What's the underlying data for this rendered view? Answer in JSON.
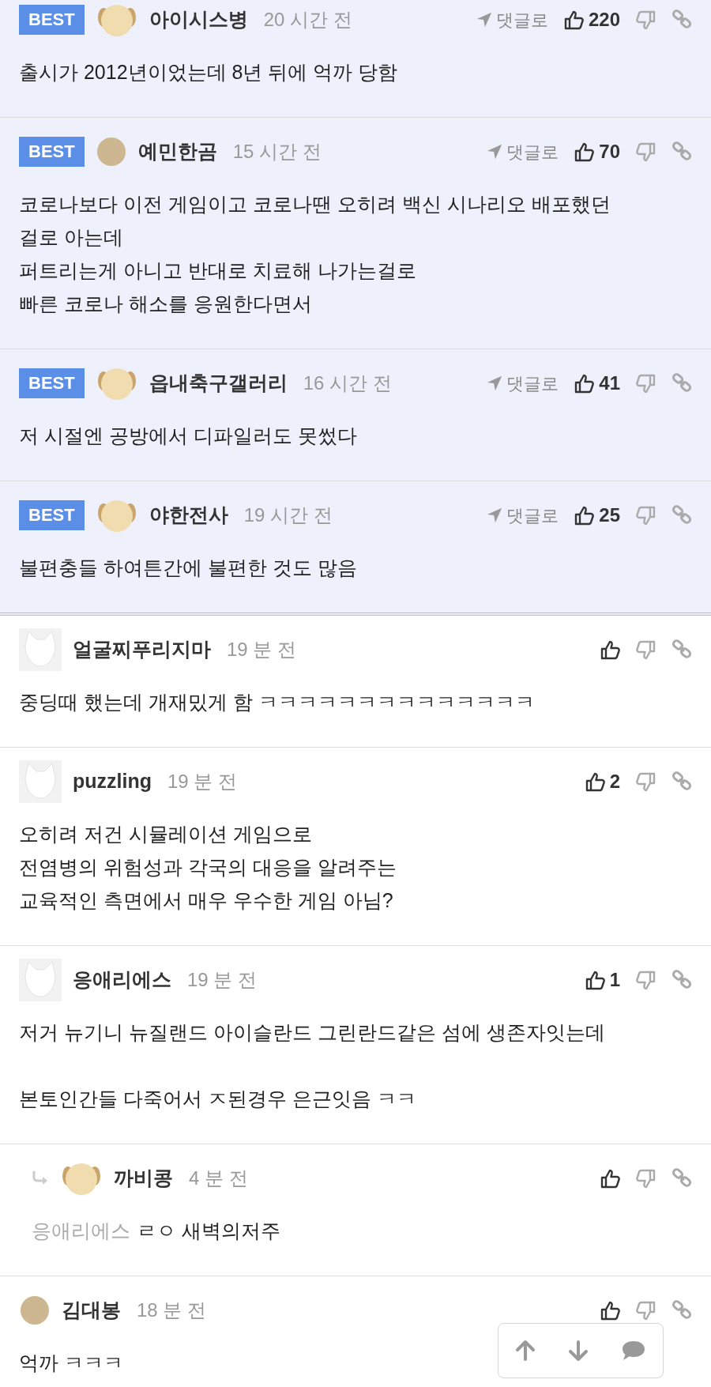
{
  "comments": [
    {
      "badge": "BEST",
      "avatar": {
        "kind": "dog"
      },
      "author": "아이시스병",
      "time": "20 시간 전",
      "reply_label": "댓글로",
      "likes": "220",
      "paragraphs": [
        "출시가 2012년이었는데 8년 뒤에 억까 당함"
      ]
    },
    {
      "badge": "BEST",
      "avatar": {
        "kind": "round"
      },
      "author": "예민한곰",
      "time": "15 시간 전",
      "reply_label": "댓글로",
      "likes": "70",
      "paragraphs": [
        "코로나보다 이전 게임이고 코로나땐 오히려 백신 시나리오 배포했던\n걸로 아는데\n퍼트리는게 아니고 반대로 치료해 나가는걸로\n빠른 코로나 해소를 응원한다면서"
      ]
    },
    {
      "badge": "BEST",
      "avatar": {
        "kind": "dog"
      },
      "author": "읍내축구갤러리",
      "time": "16 시간 전",
      "reply_label": "댓글로",
      "likes": "41",
      "paragraphs": [
        "저 시절엔 공방에서 디파일러도 못썼다"
      ]
    },
    {
      "badge": "BEST",
      "avatar": {
        "kind": "dog"
      },
      "author": "야한전사",
      "time": "19 시간 전",
      "reply_label": "댓글로",
      "likes": "25",
      "paragraphs": [
        "불편충들 하여튼간에 불편한 것도 많음"
      ]
    },
    {
      "avatar": {
        "kind": "fox"
      },
      "author": "얼굴찌푸리지마",
      "time": "19 분 전",
      "paragraphs": [
        "중딩때 했는데 개재밌게 함 ㅋㅋㅋㅋㅋㅋㅋㅋㅋㅋㅋㅋㅋㅋ"
      ]
    },
    {
      "avatar": {
        "kind": "fox"
      },
      "author": "puzzling",
      "time": "19 분 전",
      "likes": "2",
      "paragraphs": [
        "오히려 저건 시뮬레이션 게임으로\n전염병의 위험성과 각국의 대응을 알려주는\n교육적인 측면에서 매우 우수한 게임 아님?"
      ]
    },
    {
      "avatar": {
        "kind": "fox"
      },
      "author": "응애리에스",
      "time": "19 분 전",
      "likes": "1",
      "paragraphs": [
        "저거 뉴기니 뉴질랜드 아이슬란드 그린란드같은 섬에 생존자잇는데",
        "본토인간들 다죽어서 ㅈ된경우 은근잇음 ㅋㅋ"
      ]
    },
    {
      "reply": true,
      "avatar": {
        "kind": "dog"
      },
      "author": "까비콩",
      "time": "4 분 전",
      "reply_to": "응애리에스",
      "paragraphs": [
        "ㄹㅇ 새벽의저주"
      ]
    },
    {
      "avatar": {
        "kind": "round"
      },
      "author": "김대봉",
      "time": "18 분 전",
      "paragraphs": [
        "억까 ㅋㅋㅋ"
      ]
    }
  ]
}
